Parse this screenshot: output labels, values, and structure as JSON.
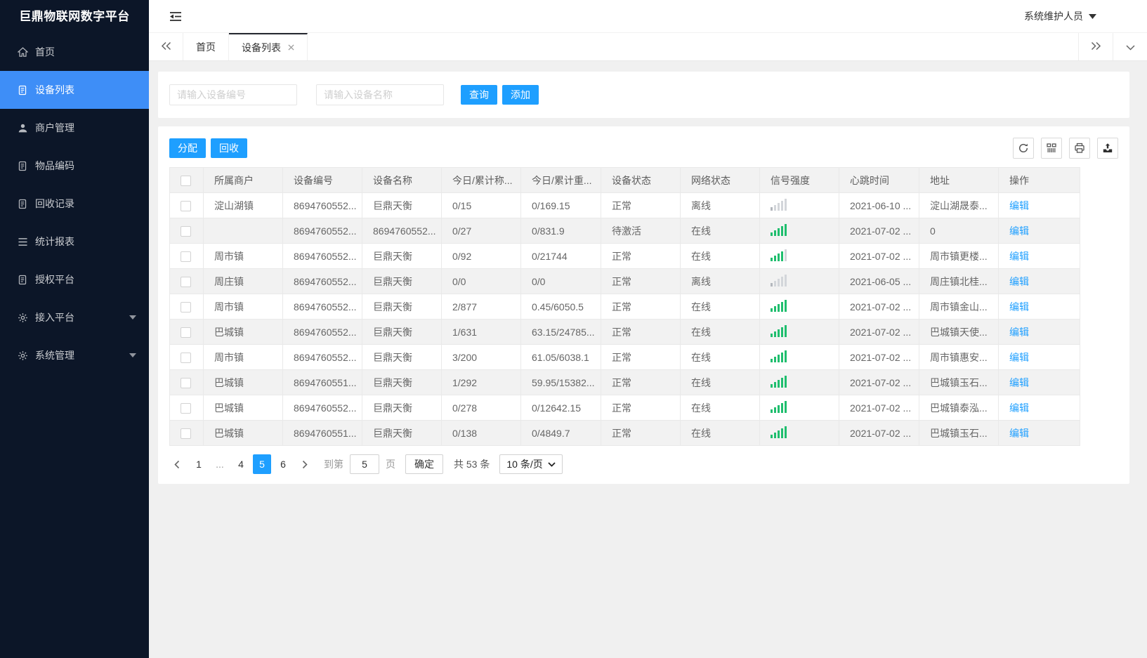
{
  "app": {
    "logo": "巨鼎物联网数字平台"
  },
  "topbar": {
    "menu_icon": "shrink-menu-icon",
    "user": "系统维护人员"
  },
  "sidebar": {
    "items": [
      {
        "label": "首页",
        "icon": "home-icon"
      },
      {
        "label": "设备列表",
        "icon": "doc-icon"
      },
      {
        "label": "商户管理",
        "icon": "user-icon"
      },
      {
        "label": "物品编码",
        "icon": "doc-icon"
      },
      {
        "label": "回收记录",
        "icon": "doc-icon"
      },
      {
        "label": "统计报表",
        "icon": "list-icon"
      },
      {
        "label": "授权平台",
        "icon": "doc-icon"
      },
      {
        "label": "接入平台",
        "icon": "gear-icon"
      },
      {
        "label": "系统管理",
        "icon": "gear-icon"
      }
    ],
    "active_label": "设备列表"
  },
  "tabs": {
    "items": [
      {
        "label": "首页"
      },
      {
        "label": "设备列表"
      }
    ],
    "active": "设备列表"
  },
  "search": {
    "device_no_placeholder": "请输入设备编号",
    "device_name_placeholder": "请输入设备名称",
    "query_label": "查询",
    "add_label": "添加"
  },
  "table_toolbar": {
    "assign_label": "分配",
    "recycle_label": "回收",
    "icons": [
      "refresh-icon",
      "columns-icon",
      "print-icon",
      "export-icon"
    ]
  },
  "table": {
    "columns": [
      "所属商户",
      "设备编号",
      "设备名称",
      "今日/累计称...",
      "今日/累计重...",
      "设备状态",
      "网络状态",
      "信号强度",
      "心跳时间",
      "地址",
      "操作"
    ],
    "rows": [
      {
        "merchant": "淀山湖镇",
        "device_no": "8694760552...",
        "device_name": "巨鼎天衡",
        "today_count": "0/15",
        "today_weight": "0/169.15",
        "device_status": "正常",
        "network_status": "离线",
        "online": false,
        "signal": 1,
        "heartbeat": "2021-06-10 ...",
        "address": "淀山湖晟泰...",
        "action": "编辑"
      },
      {
        "merchant": "",
        "device_no": "8694760552...",
        "device_name": "8694760552...",
        "today_count": "0/27",
        "today_weight": "0/831.9",
        "device_status": "待激活",
        "network_status": "在线",
        "online": true,
        "signal": 5,
        "heartbeat": "2021-07-02 ...",
        "address": "0",
        "action": "编辑"
      },
      {
        "merchant": "周市镇",
        "device_no": "8694760552...",
        "device_name": "巨鼎天衡",
        "today_count": "0/92",
        "today_weight": "0/21744",
        "device_status": "正常",
        "network_status": "在线",
        "online": true,
        "signal": 4,
        "heartbeat": "2021-07-02 ...",
        "address": "周市镇更楼...",
        "action": "编辑"
      },
      {
        "merchant": "周庄镇",
        "device_no": "8694760552...",
        "device_name": "巨鼎天衡",
        "today_count": "0/0",
        "today_weight": "0/0",
        "device_status": "正常",
        "network_status": "离线",
        "online": false,
        "signal": 1,
        "heartbeat": "2021-06-05 ...",
        "address": "周庄镇北桂...",
        "action": "编辑"
      },
      {
        "merchant": "周市镇",
        "device_no": "8694760552...",
        "device_name": "巨鼎天衡",
        "today_count": "2/877",
        "today_weight": "0.45/6050.5",
        "device_status": "正常",
        "network_status": "在线",
        "online": true,
        "signal": 5,
        "heartbeat": "2021-07-02 ...",
        "address": "周市镇金山...",
        "action": "编辑"
      },
      {
        "merchant": "巴城镇",
        "device_no": "8694760552...",
        "device_name": "巨鼎天衡",
        "today_count": "1/631",
        "today_weight": "63.15/24785...",
        "device_status": "正常",
        "network_status": "在线",
        "online": true,
        "signal": 5,
        "heartbeat": "2021-07-02 ...",
        "address": "巴城镇天使...",
        "action": "编辑"
      },
      {
        "merchant": "周市镇",
        "device_no": "8694760552...",
        "device_name": "巨鼎天衡",
        "today_count": "3/200",
        "today_weight": "61.05/6038.1",
        "device_status": "正常",
        "network_status": "在线",
        "online": true,
        "signal": 5,
        "heartbeat": "2021-07-02 ...",
        "address": "周市镇惠安...",
        "action": "编辑"
      },
      {
        "merchant": "巴城镇",
        "device_no": "8694760551...",
        "device_name": "巨鼎天衡",
        "today_count": "1/292",
        "today_weight": "59.95/15382...",
        "device_status": "正常",
        "network_status": "在线",
        "online": true,
        "signal": 5,
        "heartbeat": "2021-07-02 ...",
        "address": "巴城镇玉石...",
        "action": "编辑"
      },
      {
        "merchant": "巴城镇",
        "device_no": "8694760552...",
        "device_name": "巨鼎天衡",
        "today_count": "0/278",
        "today_weight": "0/12642.15",
        "device_status": "正常",
        "network_status": "在线",
        "online": true,
        "signal": 5,
        "heartbeat": "2021-07-02 ...",
        "address": "巴城镇泰泓...",
        "action": "编辑"
      },
      {
        "merchant": "巴城镇",
        "device_no": "8694760551...",
        "device_name": "巨鼎天衡",
        "today_count": "0/138",
        "today_weight": "0/4849.7",
        "device_status": "正常",
        "network_status": "在线",
        "online": true,
        "signal": 5,
        "heartbeat": "2021-07-02 ...",
        "address": "巴城镇玉石...",
        "action": "编辑"
      }
    ]
  },
  "pagination": {
    "pages": [
      "1",
      "...",
      "4",
      "5",
      "6"
    ],
    "current": "5",
    "goto_label": "到第",
    "goto_value": "5",
    "page_label": "页",
    "confirm_label": "确定",
    "total_label": "共 53 条",
    "page_size_label": "10 条/页"
  },
  "colors": {
    "accent_blue": "#1e9fff",
    "sidebar_active_blue": "#3e8ef7",
    "online_green": "#1fbe6e",
    "offline_red": "#f00000",
    "sidebar_bg": "#0c1628"
  }
}
